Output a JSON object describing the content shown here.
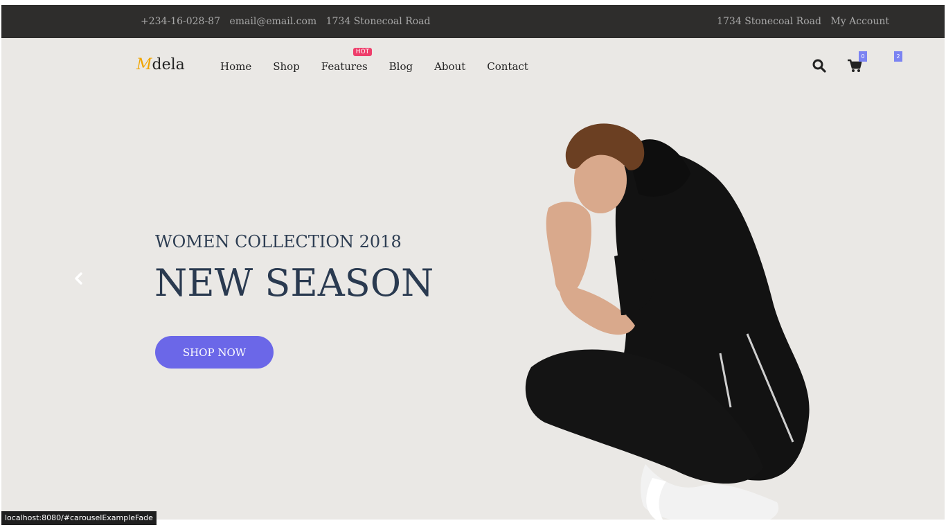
{
  "topbar": {
    "phone": "+234-16-028-87",
    "email": "email@email.com",
    "address_left": "1734 Stonecoal Road",
    "address_right": "1734 Stonecoal Road",
    "account": "My Account"
  },
  "header": {
    "logo_first": "M",
    "logo_rest": "dela",
    "nav": [
      "Home",
      "Shop",
      "Features",
      "Blog",
      "About",
      "Contact"
    ],
    "features_badge": "HOT",
    "cart_count": "0",
    "other_count": "2"
  },
  "slide": {
    "eyebrow": "WOMEN COLLECTION 2018",
    "headline": "NEW SEASON",
    "button": "SHOP NOW"
  },
  "status_bar": {
    "url": "localhost:8080/#carouselExampleFade"
  },
  "colors": {
    "accent": "#6b67e8",
    "logo_accent": "#f0a500",
    "badge": "#ee3e6b",
    "topbar": "#2e2d2c",
    "hero_bg": "#eae8e5"
  },
  "icons": [
    "search-icon",
    "cart-icon",
    "chevron-left-icon"
  ]
}
